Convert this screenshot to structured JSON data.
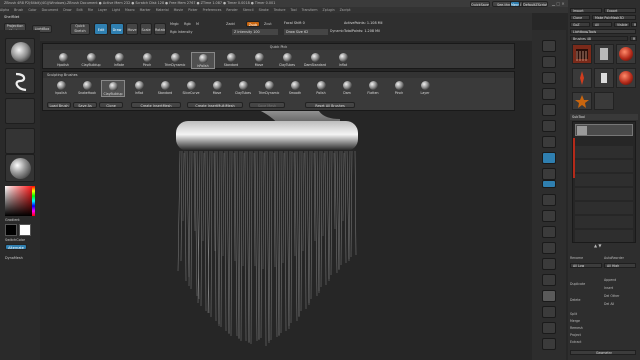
{
  "window": {
    "title": "ZBrush 4R8 P2(64bit)(4G)(Windows)-ZBrush Document   ● Active Mem 232 ● Scratch Disk 128 ● Free Mem 2767 ● ZTime 1.087 ● Timer 0.0018 ● Timer 0.001"
  },
  "menubar": [
    "Alpha",
    "Brush",
    "Color",
    "Document",
    "Draw",
    "Edit",
    "File",
    "Layer",
    "Light",
    "Macro",
    "Marker",
    "Material",
    "Movie",
    "Picker",
    "Preferences",
    "Render",
    "Stencil",
    "Stroke",
    "Texture",
    "Tool",
    "Transform",
    "Zplugin",
    "Zscript"
  ],
  "top_right": {
    "quicksave": "QuickSave",
    "seethrough": "See-through 0",
    "menus": "Menus",
    "default_zscript": "DefaultZScript"
  },
  "shelf": {
    "shelf_title": "ShelfNet",
    "projection_master": "Projection Master",
    "lightbox": "LightBox",
    "quick_sketch": "Quick Sketch",
    "edit": "Edit",
    "draw": "Draw",
    "move": "Move",
    "scale": "Scale",
    "rotate": "Rotate",
    "mrgb": "Mrgb",
    "rgb": "Rgb",
    "m": "M",
    "zadd": "Zadd",
    "zsub": "Zsub",
    "zcut": "Zcut",
    "rgb_intensity": "Rgb Intensity",
    "z_intensity": "Z Intensity 100",
    "focal_shift": "Focal Shift 0",
    "draw_size": "Draw Size 62",
    "dynamic": "Dynamic",
    "active_points": "ActivePoints: 1.108 Mil",
    "total_points": "TotalPoints: 1.208 Mil"
  },
  "left": {
    "gradient_label": "Gradient",
    "switch_color_label": "SwitchColor",
    "alternate_label": "Alternate",
    "dynamesh_label": "DynaMesh"
  },
  "quick_pick": {
    "title": "Quick Pick",
    "items": [
      "Hpolish",
      "ClayBuildup",
      "Inflate",
      "Pinch",
      "TrimDynamic",
      "hPolish",
      "Standard",
      "Move",
      "ClayTubes",
      "DamStandard",
      "Inflat"
    ],
    "selected": 5
  },
  "sculpting_brushes": {
    "title": "Sculpting Brushes",
    "items": [
      "hpolish",
      "SnakeHook",
      "ClayBuildup",
      "Inflat",
      "Standard",
      "SliceCurve",
      "Move",
      "ClayTubes",
      "TrimDynamic",
      "Smooth",
      "Polish",
      "Dam",
      "Flatten",
      "Pinch",
      "Layer"
    ],
    "selected": 2,
    "buttons": [
      "Load Brush",
      "Save As",
      "Clone",
      "Create InsertMesh",
      "Create InsertMultiMesh",
      "Reset All Brushes"
    ],
    "extra": "Save Mesh"
  },
  "tool_panel": {
    "import": "Import",
    "export": "Export",
    "clone": "Clone",
    "make_polymesh": "Make PolyMesh3D",
    "goz": "GoZ",
    "all": "All",
    "visible": "Visible",
    "r": "R",
    "lightbox_tools": "Lightbox▸Tools",
    "brush_count": "Brushes 48",
    "r_button": "R",
    "subtool_title": "SubTool",
    "rename": "Rename",
    "autoreorder": "AutoReorder",
    "all_low": "All Low",
    "all_high": "All High",
    "duplicate": "Duplicate",
    "append": "Append",
    "insert": "Insert",
    "delete": "Delete",
    "del_other": "Del Other",
    "del_all": "Del All",
    "split": "Split",
    "merge": "Merge",
    "remesh": "Remesh",
    "project": "Project",
    "extract": "Extract",
    "geometry": "Geometry"
  },
  "colors": {
    "accent_orange": "#c8650f",
    "accent_blue": "#2f7fb0",
    "subtool_red": "#b42a1a"
  }
}
